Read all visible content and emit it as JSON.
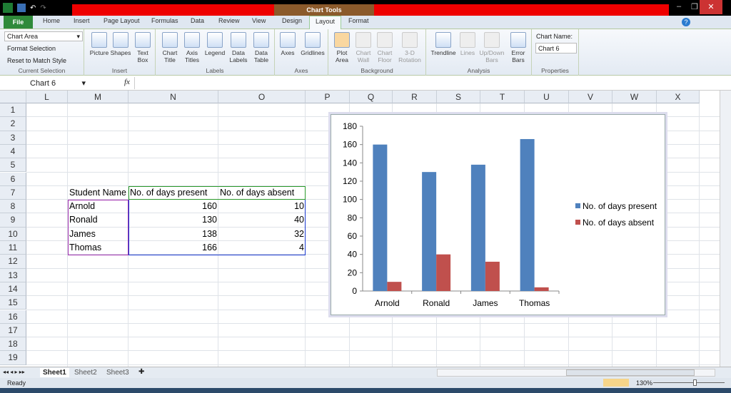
{
  "title": {
    "context": "Chart Tools"
  },
  "tabs": [
    "File",
    "Home",
    "Insert",
    "Page Layout",
    "Formulas",
    "Data",
    "Review",
    "View",
    "Design",
    "Layout",
    "Format"
  ],
  "ribbon": {
    "current_selection": {
      "dropdown": "Chart Area",
      "format": "Format Selection",
      "reset": "Reset to Match Style",
      "label": "Current Selection"
    },
    "insert": {
      "items": [
        "Picture",
        "Shapes",
        "Text Box"
      ],
      "label": "Insert"
    },
    "labels": {
      "items": [
        "Chart Title",
        "Axis Titles",
        "Legend",
        "Data Labels",
        "Data Table"
      ],
      "label": "Labels"
    },
    "axes": {
      "items": [
        "Axes",
        "Gridlines"
      ],
      "label": "Axes"
    },
    "background": {
      "items": [
        "Plot Area",
        "Chart Wall",
        "Chart Floor",
        "3-D Rotation"
      ],
      "label": "Background"
    },
    "analysis": {
      "items": [
        "Trendline",
        "Lines",
        "Up/Down Bars",
        "Error Bars"
      ],
      "label": "Analysis"
    },
    "properties": {
      "name_label": "Chart Name:",
      "name_value": "Chart 6",
      "label": "Properties"
    }
  },
  "formula_bar": {
    "name_box": "Chart 6",
    "fx": "fx",
    "value": ""
  },
  "columns": [
    "L",
    "M",
    "N",
    "O",
    "P",
    "Q",
    "R",
    "S",
    "T",
    "U",
    "V",
    "W",
    "X"
  ],
  "rows": [
    "1",
    "2",
    "3",
    "4",
    "5",
    "6",
    "7",
    "8",
    "9",
    "10",
    "11",
    "12",
    "13",
    "14",
    "15",
    "16",
    "17",
    "18",
    "19"
  ],
  "table": {
    "headers": [
      "Student Name",
      "No. of days present",
      "No. of days absent"
    ],
    "rows": [
      [
        "Arnold",
        "160",
        "10"
      ],
      [
        "Ronald",
        "130",
        "40"
      ],
      [
        "James",
        "138",
        "32"
      ],
      [
        "Thomas",
        "166",
        "4"
      ]
    ]
  },
  "chart_data": {
    "type": "bar",
    "categories": [
      "Arnold",
      "Ronald",
      "James",
      "Thomas"
    ],
    "series": [
      {
        "name": "No. of days present",
        "values": [
          160,
          130,
          138,
          166
        ],
        "color": "#4f81bd"
      },
      {
        "name": "No. of days absent",
        "values": [
          10,
          40,
          32,
          4
        ],
        "color": "#c0504d"
      }
    ],
    "ylim": [
      0,
      180
    ],
    "yticks": [
      "0",
      "20",
      "40",
      "60",
      "80",
      "100",
      "120",
      "140",
      "160",
      "180"
    ],
    "legend": "right",
    "grid": false
  },
  "sheets": [
    "Sheet1",
    "Sheet2",
    "Sheet3"
  ],
  "status": {
    "text": "Ready",
    "zoom": "130%"
  }
}
